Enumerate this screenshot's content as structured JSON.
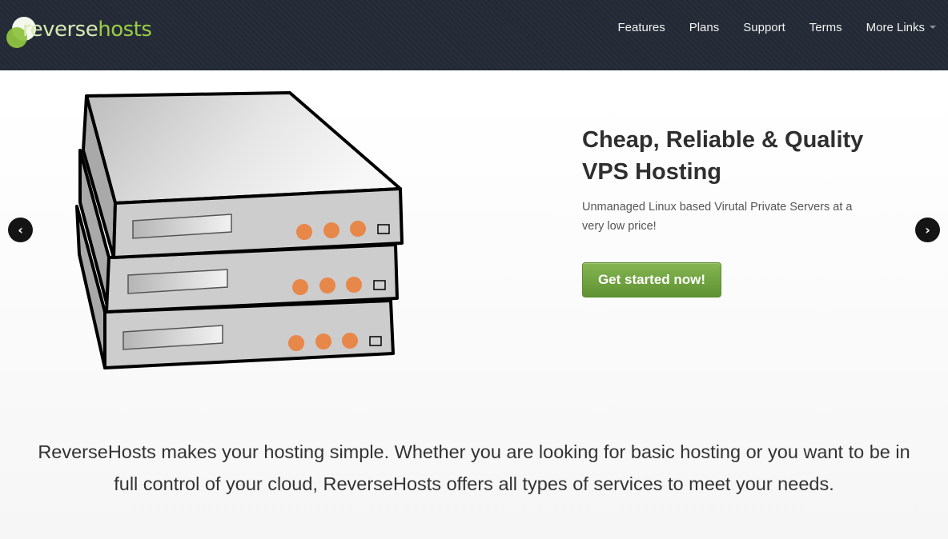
{
  "brand": {
    "logo_part1": "reverse",
    "logo_part2": "hosts",
    "colors": {
      "accent": "#9acd45",
      "navbar": "#232a36",
      "cta": "#6ea13e"
    }
  },
  "nav": {
    "items": [
      {
        "label": "Features"
      },
      {
        "label": "Plans"
      },
      {
        "label": "Support"
      },
      {
        "label": "Terms"
      },
      {
        "label": "More Links",
        "dropdown": true
      }
    ]
  },
  "carousel": {
    "prev_icon": "‹",
    "next_icon": "›",
    "image_icon": "server-stack-illustration",
    "slide": {
      "title_line1": "Cheap, Reliable & Quality",
      "title_line2": "VPS Hosting",
      "subtitle": "Unmanaged Linux based Virutal Private Servers at a very low price!",
      "cta_label": "Get started now!"
    }
  },
  "tagline": {
    "line1": "ReverseHosts makes your hosting simple. Whether you are looking for basic hosting or you want to be in",
    "line2": "full control of your cloud, ReverseHosts offers all types of services to meet your needs."
  }
}
